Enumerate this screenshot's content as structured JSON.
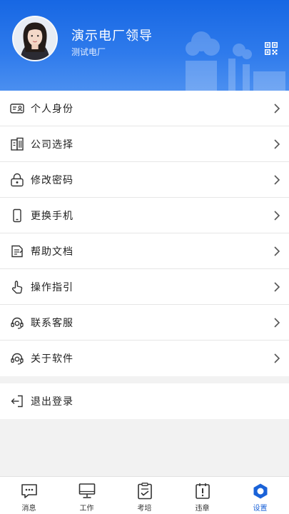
{
  "profile": {
    "name": "演示电厂领导",
    "company": "测试电厂"
  },
  "menu": [
    {
      "label": "个人身份",
      "icon": "id-card-icon"
    },
    {
      "label": "公司选择",
      "icon": "building-icon"
    },
    {
      "label": "修改密码",
      "icon": "lock-icon"
    },
    {
      "label": "更换手机",
      "icon": "phone-icon"
    },
    {
      "label": "帮助文档",
      "icon": "document-icon"
    },
    {
      "label": "操作指引",
      "icon": "hand-pointer-icon"
    },
    {
      "label": "联系客服",
      "icon": "headset-icon"
    },
    {
      "label": "关于软件",
      "icon": "headset-icon"
    }
  ],
  "logout": {
    "label": "退出登录",
    "icon": "logout-icon"
  },
  "tabs": [
    {
      "label": "消息",
      "icon": "message-icon"
    },
    {
      "label": "工作",
      "icon": "monitor-icon"
    },
    {
      "label": "考培",
      "icon": "clipboard-check-icon"
    },
    {
      "label": "违章",
      "icon": "calendar-alert-icon"
    },
    {
      "label": "设置",
      "icon": "hexagon-settings-icon",
      "active": true
    }
  ],
  "colors": {
    "brand": "#1767e3",
    "active_tab": "#1a62d8"
  }
}
